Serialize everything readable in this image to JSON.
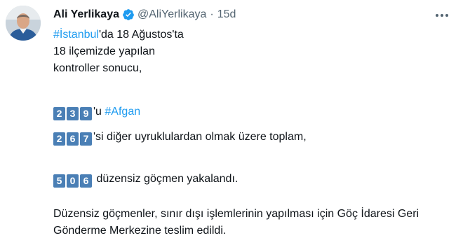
{
  "author": {
    "name": "Ali Yerlikaya",
    "handle": "@AliYerlikaya",
    "separator": "·",
    "time": "15d"
  },
  "icons": {
    "verified": "verified-badge-icon",
    "more": "more-dots-icon",
    "verified_color": "#1d9bf0"
  },
  "tweet": {
    "line1_hashtag": "#İstanbul",
    "line1_rest": "'da 18 Ağustos'ta",
    "line2": "18 ilçemizde yapılan",
    "line3": "kontroller sonucu,",
    "row1_digits": [
      "2",
      "3",
      "9"
    ],
    "row1_suffix": "'u ",
    "row1_hashtag": "#Afgan",
    "row2_digits": [
      "2",
      "6",
      "7"
    ],
    "row2_text": "'si diğer uyruklulardan olmak üzere toplam,",
    "row3_digits": [
      "5",
      "0",
      "6"
    ],
    "row3_text": " düzensiz göçmen yakalandı.",
    "final_line1": "Düzensiz göçmenler, sınır dışı işlemlerinin yapılması için Göç İdaresi Geri",
    "final_line2": "Gönderme Merkezine teslim edildi."
  }
}
